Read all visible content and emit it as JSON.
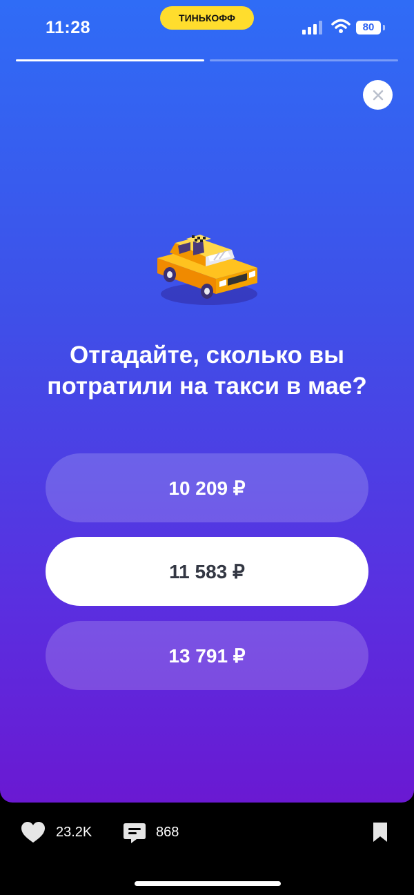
{
  "status_bar": {
    "time": "11:28",
    "brand": "ТИНЬКОФФ",
    "battery": "80"
  },
  "story": {
    "progress_segments": 2,
    "current_segment": 1,
    "image": "taxi-car-icon",
    "question": "Отгадайте, сколько вы потратили на такси в мае?",
    "answers": [
      {
        "label": "10 209 ₽",
        "selected": false
      },
      {
        "label": "11 583 ₽",
        "selected": true
      },
      {
        "label": "13 791 ₽",
        "selected": false
      }
    ]
  },
  "footer": {
    "likes": "23.2K",
    "comments": "868"
  },
  "colors": {
    "gradient_top": "#2f6cf6",
    "gradient_bottom": "#6a19d2",
    "brand_yellow": "#ffdd2d",
    "selected_answer_bg": "#ffffff"
  }
}
